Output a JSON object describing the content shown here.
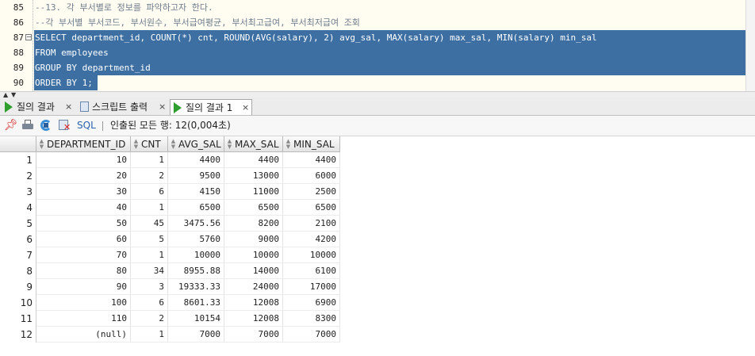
{
  "editor": {
    "lines": [
      {
        "no": "85",
        "text": "--13. 각 부서별로 정보를 파악하고자 한다.",
        "type": "comment",
        "selected": false
      },
      {
        "no": "86",
        "text": "--각 부서별 부서코드, 부서원수, 부서급여평균, 부서최고급여, 부서최저급여 조회",
        "type": "comment",
        "selected": false
      },
      {
        "no": "87",
        "text": "SELECT department_id, COUNT(*) cnt, ROUND(AVG(salary), 2) avg_sal, MAX(salary) max_sal, MIN(salary) min_sal",
        "type": "code",
        "selected": true
      },
      {
        "no": "88",
        "text": "FROM employees",
        "type": "code",
        "selected": true
      },
      {
        "no": "89",
        "text": "GROUP BY department_id",
        "type": "code",
        "selected": true
      },
      {
        "no": "90",
        "text": "ORDER BY 1;",
        "type": "code",
        "selected": true
      }
    ]
  },
  "tabs": [
    {
      "label": "질의 결과",
      "close": "×",
      "icon": "run-icon",
      "active": false
    },
    {
      "label": "스크립트 출력",
      "close": "×",
      "icon": "script-output-icon",
      "active": false
    },
    {
      "label": "질의 결과 1",
      "close": "×",
      "icon": "run-icon",
      "active": true
    }
  ],
  "toolbar": {
    "sql_label": "SQL",
    "status": "인출된 모든 행: 12(0,004초)"
  },
  "grid": {
    "columns": [
      "DEPARTMENT_ID",
      "CNT",
      "AVG_SAL",
      "MAX_SAL",
      "MIN_SAL"
    ],
    "rows": [
      {
        "n": "1",
        "cells": [
          "10",
          "1",
          "4400",
          "4400",
          "4400"
        ]
      },
      {
        "n": "2",
        "cells": [
          "20",
          "2",
          "9500",
          "13000",
          "6000"
        ]
      },
      {
        "n": "3",
        "cells": [
          "30",
          "6",
          "4150",
          "11000",
          "2500"
        ]
      },
      {
        "n": "4",
        "cells": [
          "40",
          "1",
          "6500",
          "6500",
          "6500"
        ]
      },
      {
        "n": "5",
        "cells": [
          "50",
          "45",
          "3475.56",
          "8200",
          "2100"
        ]
      },
      {
        "n": "6",
        "cells": [
          "60",
          "5",
          "5760",
          "9000",
          "4200"
        ]
      },
      {
        "n": "7",
        "cells": [
          "70",
          "1",
          "10000",
          "10000",
          "10000"
        ]
      },
      {
        "n": "8",
        "cells": [
          "80",
          "34",
          "8955.88",
          "14000",
          "6100"
        ]
      },
      {
        "n": "9",
        "cells": [
          "90",
          "3",
          "19333.33",
          "24000",
          "17000"
        ]
      },
      {
        "n": "10",
        "cells": [
          "100",
          "6",
          "8601.33",
          "12008",
          "6900"
        ]
      },
      {
        "n": "11",
        "cells": [
          "110",
          "2",
          "10154",
          "12008",
          "8300"
        ]
      },
      {
        "n": "12",
        "cells": [
          "(null)",
          "1",
          "7000",
          "7000",
          "7000"
        ]
      }
    ]
  },
  "colors": {
    "selection": "#3d6fa3",
    "editor_bg": "#fffdf2",
    "comment": "#6d7b8b",
    "run_green": "#2e9f2e"
  }
}
